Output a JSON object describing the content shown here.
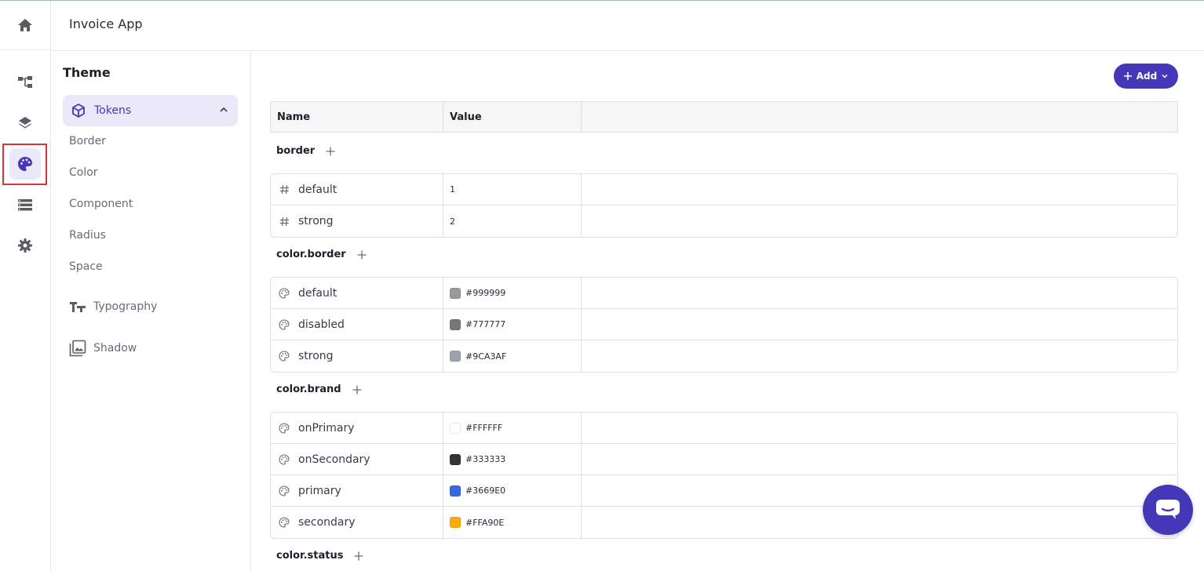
{
  "header": {
    "title": "Invoice App"
  },
  "rail": {
    "items": [
      {
        "name": "home-icon"
      },
      {
        "name": "flow-icon"
      },
      {
        "name": "layers-icon"
      },
      {
        "name": "palette-icon",
        "active": true
      },
      {
        "name": "list-icon"
      },
      {
        "name": "gear-icon"
      }
    ]
  },
  "theme": {
    "title": "Theme",
    "tokens_label": "Tokens",
    "token_items": [
      "Border",
      "Color",
      "Component",
      "Radius",
      "Space"
    ],
    "typography_label": "Typography",
    "shadow_label": "Shadow"
  },
  "toolbar": {
    "add_label": "Add"
  },
  "table": {
    "headers": {
      "name": "Name",
      "value": "Value"
    },
    "groups": [
      {
        "title": "border",
        "rows": [
          {
            "icon": "hash-icon",
            "name": "default",
            "value": "1"
          },
          {
            "icon": "hash-icon",
            "name": "strong",
            "value": "2"
          }
        ]
      },
      {
        "title": "color.border",
        "rows": [
          {
            "icon": "palette-icon",
            "name": "default",
            "value": "#999999",
            "swatch": "#999999"
          },
          {
            "icon": "palette-icon",
            "name": "disabled",
            "value": "#777777",
            "swatch": "#777777"
          },
          {
            "icon": "palette-icon",
            "name": "strong",
            "value": "#9CA3AF",
            "swatch": "#9CA3AF"
          }
        ]
      },
      {
        "title": "color.brand",
        "rows": [
          {
            "icon": "palette-icon",
            "name": "onPrimary",
            "value": "#FFFFFF",
            "swatch": "#FFFFFF"
          },
          {
            "icon": "palette-icon",
            "name": "onSecondary",
            "value": "#333333",
            "swatch": "#333333"
          },
          {
            "icon": "palette-icon",
            "name": "primary",
            "value": "#3669E0",
            "swatch": "#3669E0"
          },
          {
            "icon": "palette-icon",
            "name": "secondary",
            "value": "#FFA90E",
            "swatch": "#FFA90E"
          }
        ]
      },
      {
        "title": "color.status",
        "rows": []
      }
    ]
  },
  "colors": {
    "accent": "#4438b8",
    "accent_bg": "#ebe9f9",
    "highlight": "#d93434"
  }
}
